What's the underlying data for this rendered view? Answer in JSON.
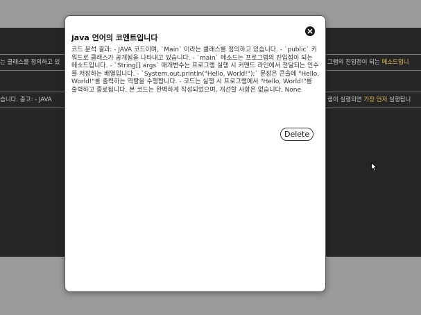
{
  "background": {
    "row1_left": "는 클래스를 정의하고 있",
    "row1_right_pre": "그램의 진입점이 되는 ",
    "row1_right_hl": "메소드입니",
    "row2_left": "습니다. 충고: - JAVA",
    "row2_right_pre": "램이 실행되면 ",
    "row2_right_hl": "가장 먼저",
    "row2_right_post": " 실행됩니"
  },
  "modal": {
    "title": "java 언어의 코멘트입니다",
    "body": "코드 분석 결과: - JAVA 코드이며, `Main` 이라는 클래스를 정의하고 있습니다. - `public` 키워드로 클래스가 공개됨을 나타내고 있습니다. - `main` 메소드는 프로그램의 진입점이 되는 메소드입니다. - `String[] args` 매개변수는 프로그램 실행 시 커맨드 라인에서 전달되는 인수를 저장하는 배열입니다. - `System.out.println(\"Hello, World!\");` 문장은 콘솔에 \"Hello, World!\"를 출력하는 역할을 수행합니다. - 코드는 실행 시 프로그램에서 \"Hello, World!\"를 출력하고 종료됩니다. 본 코드는 완벽하게 작성되었으며, 개선할 사항은 없습니다. None",
    "delete_label": "Delete",
    "close_icon": "close-icon"
  },
  "colors": {
    "overlay": "#9b9b9b",
    "page_dark": "#262626",
    "highlight": "#e6b85c"
  }
}
